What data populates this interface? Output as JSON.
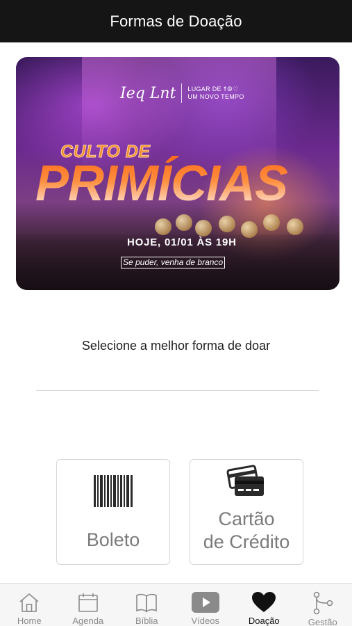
{
  "header": {
    "title": "Formas de Doação"
  },
  "banner": {
    "logo_script": "Ieq Lnt",
    "logo_tag_line1": "LUGAR DE ☨☮♡",
    "logo_tag_line2": "UM NOVO TEMPO",
    "headline_small": "CULTO DE",
    "headline_large": "PRIMÍCIAS",
    "schedule": "HOJE, 01/01 ÀS 19H",
    "note": "Se puder, venha de branco"
  },
  "main": {
    "subtitle": "Selecione a melhor forma de doar",
    "options": [
      {
        "label": "Boleto",
        "icon": "barcode-icon"
      },
      {
        "label_line1": "Cartão",
        "label_line2": "de Crédito",
        "icon": "credit-card-icon"
      }
    ]
  },
  "tabbar": {
    "active": "Doação",
    "items": [
      {
        "label": "Home",
        "icon": "home-icon"
      },
      {
        "label": "Agenda",
        "icon": "calendar-icon"
      },
      {
        "label": "Bíblia",
        "icon": "bible-icon"
      },
      {
        "label": "Vídeos",
        "icon": "play-icon"
      },
      {
        "label": "Doação",
        "icon": "heart-icon"
      },
      {
        "label": "Gestão",
        "icon": "branch-icon"
      }
    ]
  },
  "colors": {
    "topbar": "#151515",
    "option_text": "#7b7b7b",
    "tab_inactive": "#8a8a8a",
    "tab_active": "#111111",
    "headline_orange": "#f38b28"
  }
}
